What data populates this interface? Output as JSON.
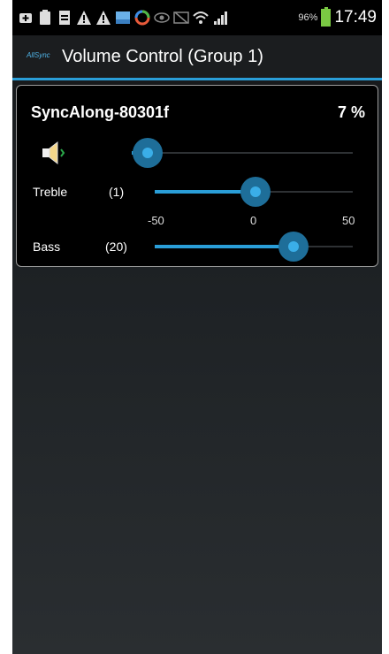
{
  "status_bar": {
    "icons": [
      "plus-icon",
      "clipboard-icon",
      "document-icon",
      "warning-icon",
      "warning-icon",
      "image-icon",
      "sync-icon",
      "eye-icon",
      "mute-icon",
      "wifi-icon",
      "signal-icon"
    ],
    "battery": "96%",
    "time": "17:49"
  },
  "action_bar": {
    "logo": "AllSync",
    "title": "Volume Control (Group 1)"
  },
  "device": {
    "name": "SyncAlong-80301f",
    "volume_display": "7 %",
    "volume_value": 7,
    "speaker_icon": "speaker-icon",
    "treble": {
      "label": "Treble",
      "value_display": "(1)",
      "value": 1
    },
    "bass": {
      "label": "Bass",
      "value_display": "(20)",
      "value": 20
    },
    "scale": {
      "min": "-50",
      "mid": "0",
      "max": "50"
    }
  },
  "colors": {
    "accent": "#2a9ed8",
    "battery": "#7ac943"
  }
}
